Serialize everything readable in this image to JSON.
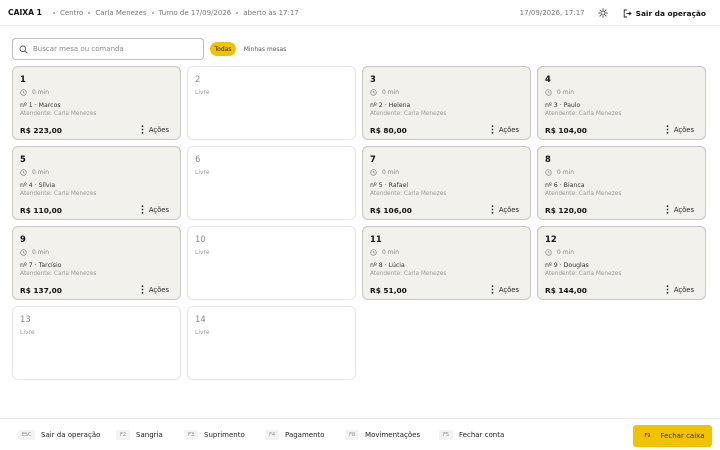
{
  "header": {
    "title": "CAIXA 1",
    "location": "Centro",
    "operator": "Carla Menezes",
    "shift": "Turno de 17/09/2026",
    "opened": "aberto às 17:17",
    "datetime": "17/09/2026, 17:17",
    "exit_label": "Sair da operação",
    "icons": {
      "settings": "sun-gear-icon",
      "exit": "logout-icon"
    }
  },
  "search": {
    "placeholder": "Buscar mesa ou comanda",
    "value": ""
  },
  "filters": [
    {
      "label": "Todas",
      "active": true
    },
    {
      "label": "Minhas mesas",
      "active": false
    }
  ],
  "table_labels": {
    "free": "Livre",
    "actions": "Ações"
  },
  "tables": [
    {
      "number": "1",
      "status": "occupied",
      "time": "0 min",
      "comanda": "nº 1 · Marcos",
      "attendant": "Atendente: Carla Menezes",
      "total": "R$ 223,00"
    },
    {
      "number": "2",
      "status": "free"
    },
    {
      "number": "3",
      "status": "occupied",
      "time": "0 min",
      "comanda": "nº 2 · Helena",
      "attendant": "Atendente: Carla Menezes",
      "total": "R$ 80,00"
    },
    {
      "number": "4",
      "status": "occupied",
      "time": "0 min",
      "comanda": "nº 3 · Paulo",
      "attendant": "Atendente: Carla Menezes",
      "total": "R$ 104,00"
    },
    {
      "number": "5",
      "status": "occupied",
      "time": "0 min",
      "comanda": "nº 4 · Sílvia",
      "attendant": "Atendente: Carla Menezes",
      "total": "R$ 110,00"
    },
    {
      "number": "6",
      "status": "free"
    },
    {
      "number": "7",
      "status": "occupied",
      "time": "0 min",
      "comanda": "nº 5 · Rafael",
      "attendant": "Atendente: Carla Menezes",
      "total": "R$ 106,00"
    },
    {
      "number": "8",
      "status": "occupied",
      "time": "0 min",
      "comanda": "nº 6 · Bianca",
      "attendant": "Atendente: Carla Menezes",
      "total": "R$ 120,00"
    },
    {
      "number": "9",
      "status": "occupied",
      "time": "0 min",
      "comanda": "nº 7 · Tarcísio",
      "attendant": "Atendente: Carla Menezes",
      "total": "R$ 137,00"
    },
    {
      "number": "10",
      "status": "free"
    },
    {
      "number": "11",
      "status": "occupied",
      "time": "0 min",
      "comanda": "nº 8 · Lúcia",
      "attendant": "Atendente: Carla Menezes",
      "total": "R$ 51,00"
    },
    {
      "number": "12",
      "status": "occupied",
      "time": "0 min",
      "comanda": "nº 9 · Douglas",
      "attendant": "Atendente: Carla Menezes",
      "total": "R$ 144,00"
    },
    {
      "number": "13",
      "status": "free"
    },
    {
      "number": "14",
      "status": "free"
    }
  ],
  "footer": {
    "keys": [
      {
        "key": "ESC",
        "label": "Sair da operação"
      },
      {
        "key": "F2",
        "label": "Sangria"
      },
      {
        "key": "F3",
        "label": "Suprimento"
      },
      {
        "key": "F4",
        "label": "Pagamento"
      },
      {
        "key": "F8",
        "label": "Movimentações"
      },
      {
        "key": "F5",
        "label": "Fechar conta"
      }
    ],
    "primary": {
      "key": "F9",
      "label": "Fechar caixa"
    }
  },
  "colors": {
    "accent": "#f2c200",
    "occupied_bg": "#f2f1ec",
    "occupied_border": "#c8c7c1",
    "free_border": "#e6e6e6"
  }
}
